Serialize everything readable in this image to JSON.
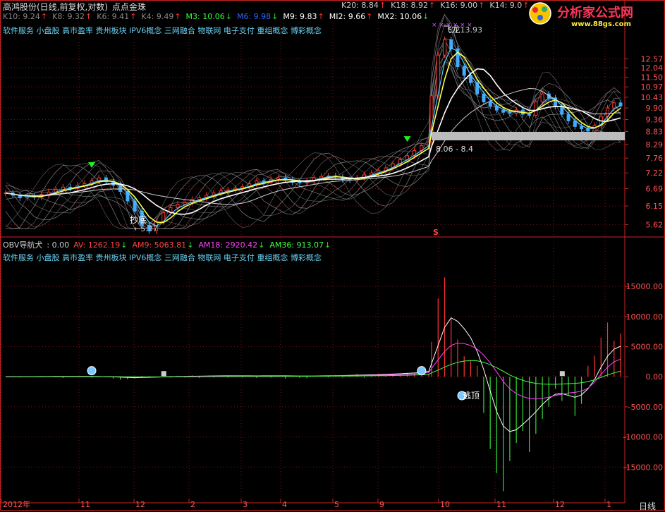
{
  "title": "高鸿股份(日线,前复权,对数)",
  "formula": "点点金珠",
  "main_ma_row1": [
    {
      "label": "K10: 9.24",
      "color": "#888888",
      "dir": "up"
    },
    {
      "label": "K8: 9.32",
      "color": "#888888",
      "dir": "up"
    },
    {
      "label": "K6: 9.41",
      "color": "#888888",
      "dir": "up"
    },
    {
      "label": "K4: 9.49",
      "color": "#888888",
      "dir": "up"
    },
    {
      "label": "M3: 10.06",
      "color": "#33ff33",
      "dir": "down"
    },
    {
      "label": "M6: 9.98",
      "color": "#3366ff",
      "dir": "down"
    },
    {
      "label": "M9: 9.83",
      "color": "#ffffff",
      "dir": "up"
    },
    {
      "label": "MI2: 9.66",
      "color": "#ffffff",
      "dir": "up"
    },
    {
      "label": "MX2: 10.06",
      "color": "#ffffff",
      "dir": "down"
    }
  ],
  "main_ma_row_right": [
    {
      "label": "K20: 8.84",
      "color": "#cccccc",
      "dir": "up"
    },
    {
      "label": "K18: 8.92",
      "color": "#cccccc",
      "dir": "up"
    },
    {
      "label": "K16: 9.00",
      "color": "#cccccc",
      "dir": "up"
    },
    {
      "label": "K14: 9.0",
      "color": "#cccccc",
      "dir": "up"
    }
  ],
  "concepts": "软件服务 小盘股 高市盈率 贵州板块 IPV6概念 三网融合 物联网 电子支付 重组概念 博彩概念",
  "logo": {
    "cn": "分析家公式网",
    "url": "www.88gs.com"
  },
  "colors": {
    "up": "#ff3333",
    "down": "#33dd33",
    "yellow": "#ffff44",
    "white": "#ffffff",
    "grid": "#7a1010",
    "axis": "#cc2222"
  },
  "annotations": {
    "low_label": "抄底",
    "low_value": "←5.37",
    "high_label": "飞龙",
    "high_value": "13.93",
    "range_label": "8.06 - 8.4",
    "sell_mark": "S",
    "obv_top_label": "逃顶"
  },
  "obv_header": [
    {
      "label": "OBV导航犬",
      "color": "#cccccc",
      "dir": ""
    },
    {
      "label": ": 0.00",
      "color": "#cccccc",
      "dir": ""
    },
    {
      "label": "AV: 1262.19",
      "color": "#ff4444",
      "dir": "down"
    },
    {
      "label": "AM9: 5063.81",
      "color": "#ff4444",
      "dir": "down"
    },
    {
      "label": "AM18: 2920.42",
      "color": "#ff44ff",
      "dir": "down"
    },
    {
      "label": "AM36: 913.07",
      "color": "#44ff44",
      "dir": "down"
    }
  ],
  "time_axis": {
    "labels": [
      "2012年",
      "11",
      "12",
      "2",
      "3",
      "4",
      "5",
      "9",
      "10",
      "11",
      "12",
      "1"
    ],
    "period": "日线"
  },
  "chart_data": [
    {
      "type": "candlestick",
      "title": "高鸿股份(日线,前复权,对数)",
      "y_scale": "log",
      "ylim": [
        5.4,
        14.0
      ],
      "y_ticks": [
        5.62,
        6.15,
        6.69,
        7.22,
        7.76,
        8.29,
        8.83,
        9.36,
        9.9,
        10.43,
        10.97,
        11.5,
        12.04,
        12.57
      ],
      "x_categories": [
        "2012年",
        "11",
        "12",
        "2",
        "3",
        "4",
        "5",
        "9",
        "10",
        "11",
        "12",
        "1"
      ],
      "close_series": [
        6.55,
        6.48,
        6.4,
        6.45,
        6.42,
        6.5,
        6.58,
        6.66,
        6.74,
        6.7,
        6.8,
        6.86,
        6.95,
        7.05,
        6.92,
        6.8,
        6.6,
        6.3,
        6.0,
        5.6,
        5.45,
        5.7,
        5.95,
        6.1,
        6.2,
        6.25,
        6.35,
        6.4,
        6.48,
        6.55,
        6.62,
        6.65,
        6.7,
        6.75,
        6.85,
        6.95,
        6.9,
        7.0,
        7.05,
        6.98,
        6.9,
        6.88,
        6.95,
        7.05,
        7.1,
        7.12,
        7.08,
        7.0,
        6.98,
        7.05,
        7.15,
        7.22,
        7.3,
        7.4,
        7.55,
        7.7,
        7.85,
        8.05,
        8.25,
        8.4,
        10.5,
        12.8,
        13.8,
        13.2,
        12.1,
        11.6,
        11.2,
        10.6,
        10.2,
        10.0,
        9.8,
        9.7,
        9.65,
        9.8,
        9.6,
        9.55,
        10.2,
        10.6,
        10.4,
        10.0,
        9.6,
        9.3,
        9.05,
        8.95,
        8.85,
        9.1,
        9.5,
        9.9,
        10.15,
        10.0
      ],
      "annotations": [
        "抄底 ←5.37",
        "飞龙 13.93",
        "8.06 - 8.4",
        "S"
      ]
    },
    {
      "type": "bar",
      "title": "OBV导航犬",
      "ylim": [
        -20000,
        19000
      ],
      "y_ticks": [
        -15000,
        -10000,
        -5000,
        0,
        5000,
        10000,
        15000
      ],
      "series": [
        {
          "name": "AV",
          "values": [
            50,
            80,
            -120,
            60,
            -90,
            110,
            -60,
            150,
            -200,
            90,
            -80,
            130,
            -150,
            100,
            -60,
            -300,
            -500,
            -420,
            -250,
            160,
            120,
            -90,
            210,
            -140,
            180,
            -120,
            250,
            -180,
            160,
            -100,
            200,
            -150,
            220,
            -120,
            180,
            -200,
            260,
            -160,
            140,
            -300,
            200,
            -180,
            -230,
            150,
            240,
            -120,
            300,
            -160,
            220,
            500,
            -180,
            420,
            520,
            300,
            380,
            260,
            640,
            420,
            320,
            560,
            5800,
            13000,
            16500,
            9800,
            6200,
            3400,
            2600,
            1800,
            -6000,
            -12000,
            -16000,
            -19000,
            -14000,
            -11000,
            -9000,
            -12500,
            -9500,
            -7000,
            -5000,
            -2000,
            -4000,
            -3000,
            -6500,
            -4500,
            1800,
            3500,
            6500,
            9000,
            6000,
            7200
          ]
        },
        {
          "name": "AM9",
          "values": [
            20,
            20,
            25,
            28,
            30,
            34,
            40,
            45,
            45,
            48,
            52,
            55,
            50,
            40,
            20,
            -20,
            -60,
            -120,
            -160,
            -140,
            -100,
            -60,
            -20,
            20,
            40,
            60,
            80,
            100,
            120,
            140,
            160,
            170,
            175,
            170,
            165,
            160,
            165,
            170,
            175,
            170,
            160,
            150,
            140,
            145,
            155,
            165,
            180,
            200,
            230,
            260,
            290,
            320,
            360,
            400,
            450,
            500,
            560,
            620,
            700,
            900,
            2200,
            5200,
            8200,
            9800,
            9200,
            8000,
            6500,
            4200,
            1200,
            -2400,
            -5800,
            -8200,
            -9100,
            -8800,
            -7900,
            -6900,
            -5800,
            -4600,
            -3600,
            -2900,
            -2800,
            -3100,
            -3400,
            -3000,
            -2000,
            -500,
            1600,
            3400,
            4600,
            5063
          ]
        },
        {
          "name": "AM18",
          "values": [
            10,
            12,
            14,
            16,
            18,
            20,
            22,
            24,
            26,
            28,
            30,
            30,
            28,
            25,
            20,
            10,
            -10,
            -40,
            -70,
            -80,
            -70,
            -50,
            -30,
            -10,
            10,
            30,
            50,
            70,
            90,
            110,
            125,
            135,
            140,
            142,
            142,
            140,
            140,
            142,
            145,
            148,
            150,
            150,
            148,
            148,
            150,
            155,
            162,
            170,
            180,
            195,
            210,
            230,
            255,
            285,
            320,
            360,
            410,
            470,
            550,
            700,
            1400,
            2800,
            4200,
            5200,
            5600,
            5500,
            5200,
            4600,
            3600,
            2300,
            800,
            -800,
            -2000,
            -2800,
            -3300,
            -3600,
            -3700,
            -3600,
            -3400,
            -3100,
            -2900,
            -2700,
            -2600,
            -2400,
            -1900,
            -900,
            400,
            1600,
            2500,
            2920
          ]
        },
        {
          "name": "AM36",
          "values": [
            5,
            6,
            7,
            8,
            9,
            10,
            11,
            12,
            13,
            14,
            15,
            15,
            15,
            14,
            12,
            8,
            2,
            -6,
            -14,
            -20,
            -22,
            -20,
            -16,
            -10,
            -4,
            2,
            8,
            14,
            20,
            26,
            32,
            38,
            44,
            50,
            55,
            60,
            64,
            68,
            72,
            76,
            80,
            84,
            88,
            92,
            96,
            100,
            106,
            112,
            120,
            130,
            140,
            152,
            166,
            182,
            200,
            222,
            248,
            280,
            320,
            380,
            650,
            1100,
            1600,
            2050,
            2400,
            2600,
            2700,
            2650,
            2400,
            2000,
            1500,
            900,
            300,
            -200,
            -600,
            -900,
            -1100,
            -1200,
            -1250,
            -1250,
            -1200,
            -1150,
            -1100,
            -1000,
            -800,
            -500,
            -100,
            300,
            650,
            913
          ]
        }
      ],
      "annotations": [
        "逃顶"
      ]
    }
  ]
}
